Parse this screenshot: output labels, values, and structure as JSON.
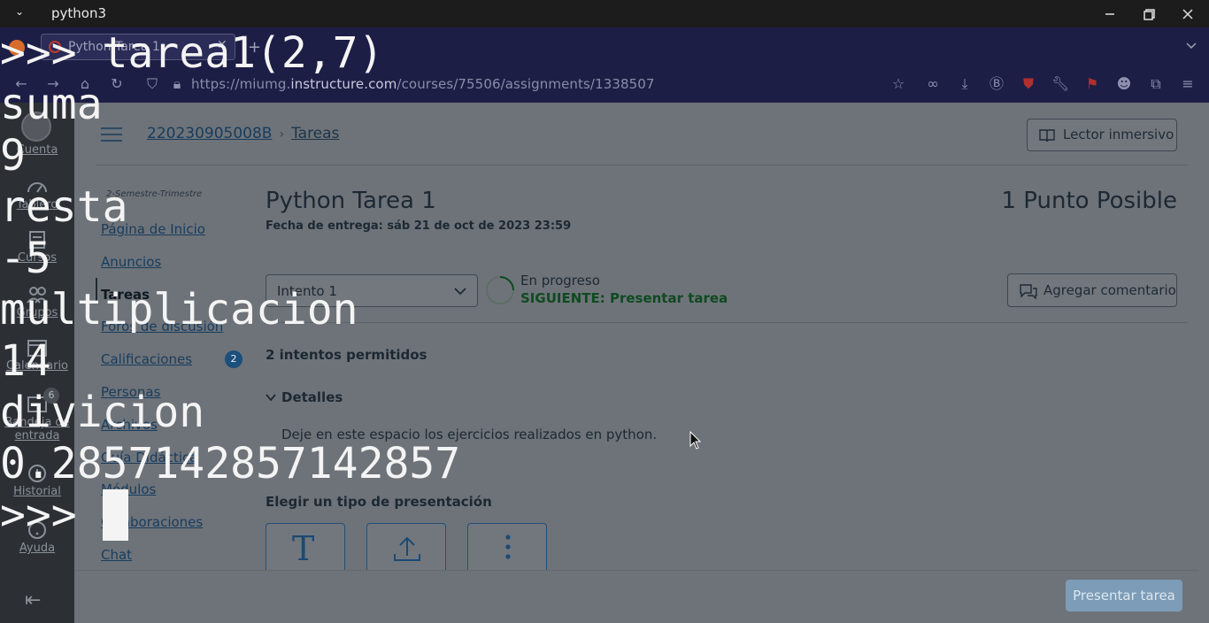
{
  "terminal_window": {
    "title": "python3",
    "lines": [
      ">>> tarea1(2,7)",
      "suma",
      "9",
      "resta",
      "-5",
      "multiplicacion",
      "14",
      "divicion",
      "0.2857142857142857",
      ">>> "
    ]
  },
  "browser": {
    "tab_title": "Python Tarea 1",
    "url_prefix": "https://miumg.",
    "url_host": "instructure.com",
    "url_path": "/courses/75506/assignments/1338507"
  },
  "rail": {
    "items": [
      {
        "label": "Cuenta",
        "icon": "avatar"
      },
      {
        "label": "Tablero",
        "icon": "dashboard-icon"
      },
      {
        "label": "Cursos",
        "icon": "courses-icon"
      },
      {
        "label": "Grupos",
        "icon": "groups-icon"
      },
      {
        "label": "Calendario",
        "icon": "calendar-icon"
      },
      {
        "label": "Bandeja de",
        "label2": "entrada",
        "icon": "inbox-icon",
        "badge": "6"
      },
      {
        "label": "Historial",
        "icon": "history-icon"
      },
      {
        "label": "Ayuda",
        "icon": "help-icon"
      }
    ]
  },
  "header": {
    "course_code": "220230905008B",
    "section": "Tareas",
    "immersive_reader": "Lector inmersivo"
  },
  "course_nav": {
    "term": "2-Semestre-Trimestre",
    "items": [
      "Página de Inicio",
      "Anuncios",
      "Tareas",
      "Foros de discusión",
      "Calificaciones",
      "Personas",
      "Archivos",
      "Guía Didáctica",
      "Módulos",
      "Colaboraciones",
      "Chat"
    ],
    "grades_badge": "2"
  },
  "assignment": {
    "title": "Python Tarea 1",
    "points": "1 Punto Posible",
    "due": "Fecha de entrega: sáb 21 de oct de 2023 23:59",
    "attempt": "Intento 1",
    "status": "En progreso",
    "next_step": "SIGUIENTE: Presentar tarea",
    "add_comment": "Agregar comentario",
    "attempts_allowed": "2 intentos permitidos",
    "details_label": "Detalles",
    "details_text": "Deje en este espacio los ejercicios realizados en python.",
    "submission_type_label": "Elegir un tipo de presentación",
    "submit": "Presentar tarea"
  },
  "colors": {
    "link": "#173c5e",
    "success": "#0f4a20",
    "badge": "#1b4f7c"
  }
}
